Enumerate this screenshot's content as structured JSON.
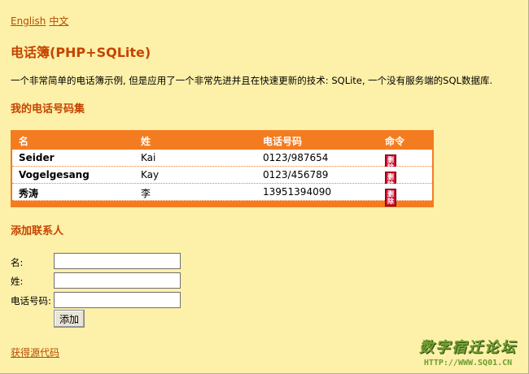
{
  "lang_links": {
    "english": "English",
    "chinese": "中文"
  },
  "page_title": "电话簿(PHP+SQLite)",
  "intro": "一个非常简单的电话簿示例, 但是应用了一个非常先进并且在快速更新的技术: SQLite, 一个没有服务端的SQL数据库.",
  "phonebook": {
    "heading": "我的电话号码集",
    "columns": [
      "名",
      "姓",
      "电话号码",
      "命令"
    ],
    "rows": [
      {
        "first": "Seider",
        "last": "Kai",
        "phone": "0123/987654",
        "action": "删除"
      },
      {
        "first": "Vogelgesang",
        "last": "Kay",
        "phone": "0123/456789",
        "action": "删除"
      },
      {
        "first": "秀涛",
        "last": "李",
        "phone": "13951394090",
        "action": "删除"
      }
    ]
  },
  "add_contact": {
    "heading": "添加联系人",
    "first_label": "名:",
    "last_label": "姓:",
    "phone_label": "电话号码:",
    "first_value": "",
    "last_value": "",
    "phone_value": "",
    "submit_label": "添加"
  },
  "source_link": "获得源代码",
  "watermark": {
    "title": "数字宿迁论坛",
    "url": "HTTP://WWW.SQ01.CN"
  },
  "colors": {
    "background": "#fdf0a9",
    "accent": "#f47c20",
    "heading": "#c44500",
    "link": "#b44d00"
  }
}
